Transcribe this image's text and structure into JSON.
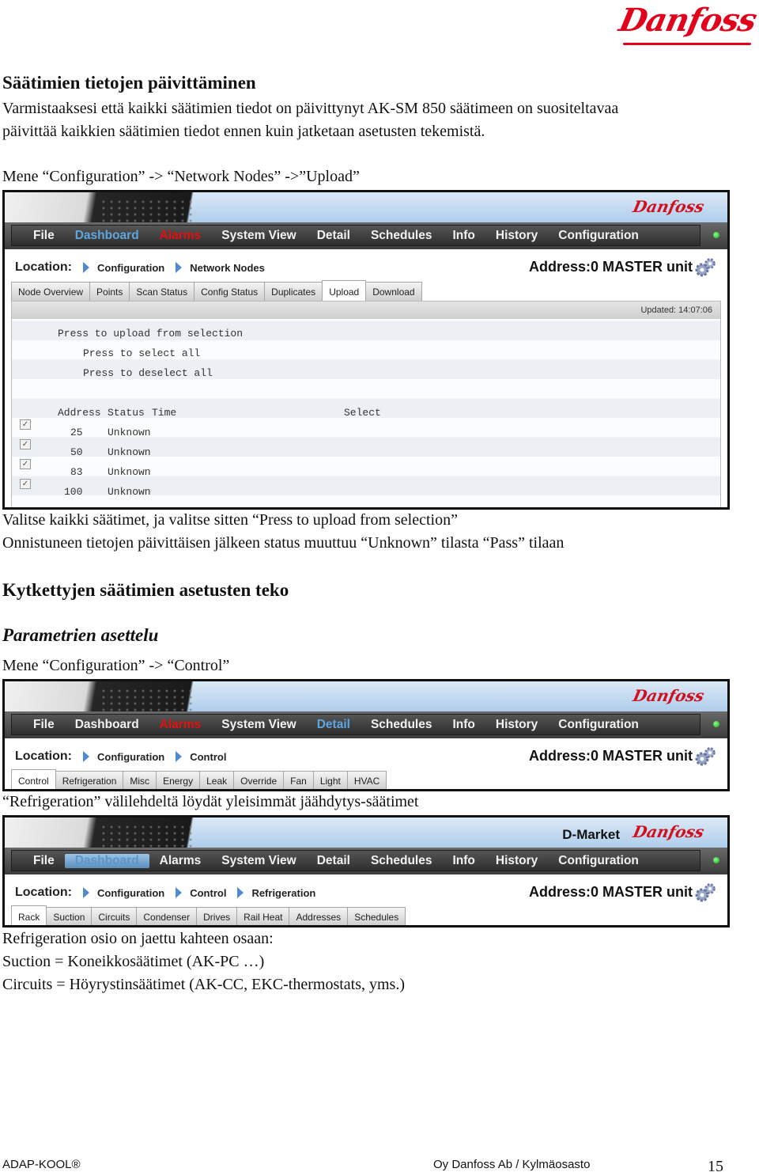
{
  "brand": {
    "logo_text": "Danfoss",
    "color": "#e2001a"
  },
  "section1": {
    "heading": "Säätimien tietojen päivittäminen",
    "intro_line1": "Varmistaaksesi että kaikki säätimien tiedot on päivittynyt AK-SM 850 säätimeen on suositeltavaa",
    "intro_line2": "päivittää kaikkien säätimien tiedot ennen kuin jatketaan asetusten tekemistä.",
    "instruction": "Mene “Configuration” -> “Network Nodes” ->”Upload”",
    "after_line1": "Valitse kaikki säätimet, ja valitse sitten “Press to upload from selection”",
    "after_line2": "Onnistuneen tietojen päivittäisen jälkeen status muuttuu “Unknown” tilasta “Pass” tilaan"
  },
  "section2": {
    "heading": "Kytkettyjen säätimien asetusten teko",
    "subheading": "Parametrien asettelu",
    "instruction": "Mene “Configuration” -> “Control”",
    "refrigeration_note": "“Refrigeration” välilehdeltä löydät yleisimmät jäähdytys-säätimet",
    "summary_line1": "Refrigeration osio on jaettu kahteen osaan:",
    "summary_line2": "Suction = Koneikkosäätimet (AK-PC …)",
    "summary_line3": "Circuits = Höyrystinsäätimet (AK-CC, EKC-thermostats, yms.)"
  },
  "app": {
    "logo_text": "Danfoss",
    "menu": [
      "File",
      "Dashboard",
      "Alarms",
      "System View",
      "Detail",
      "Schedules",
      "Info",
      "History",
      "Configuration"
    ],
    "location_label": "Location:",
    "address": "Address:0 MASTER unit",
    "status_led_color": "#1fbf1f",
    "alarm_color": "#e41010",
    "active_color": "#5ea6e0"
  },
  "screen1": {
    "breadcrumb": [
      "Configuration",
      "Network Nodes"
    ],
    "tabs": [
      "Node Overview",
      "Points",
      "Scan Status",
      "Config Status",
      "Duplicates",
      "Upload",
      "Download"
    ],
    "active_tab": "Upload",
    "active_menu": "Dashboard",
    "updated": "Updated: 14:07:06",
    "actions": [
      "Press to upload from selection",
      "Press to select all",
      "Press to deselect all"
    ],
    "table_header": {
      "address": "Address",
      "status": "Status",
      "time": "Time",
      "select": "Select"
    },
    "rows": [
      {
        "address": "25",
        "status": "Unknown",
        "checked": true
      },
      {
        "address": "50",
        "status": "Unknown",
        "checked": true
      },
      {
        "address": "83",
        "status": "Unknown",
        "checked": true
      },
      {
        "address": "100",
        "status": "Unknown",
        "checked": true
      }
    ]
  },
  "screen2": {
    "breadcrumb": [
      "Configuration",
      "Control"
    ],
    "tabs": [
      "Control",
      "Refrigeration",
      "Misc",
      "Energy",
      "Leak",
      "Override",
      "Fan",
      "Light",
      "HVAC"
    ],
    "active_tab": "Control",
    "active_menu": "Detail"
  },
  "screen3": {
    "site_name": "D-Market",
    "breadcrumb": [
      "Configuration",
      "Control",
      "Refrigeration"
    ],
    "tabs": [
      "Rack",
      "Suction",
      "Circuits",
      "Condenser",
      "Drives",
      "Rail Heat",
      "Addresses",
      "Schedules"
    ],
    "active_tab": "Rack",
    "active_menu": "Dashboard"
  },
  "footer": {
    "left": "ADAP-KOOL®",
    "center": "Oy Danfoss Ab / Kylmäosasto",
    "page_number": "15"
  }
}
